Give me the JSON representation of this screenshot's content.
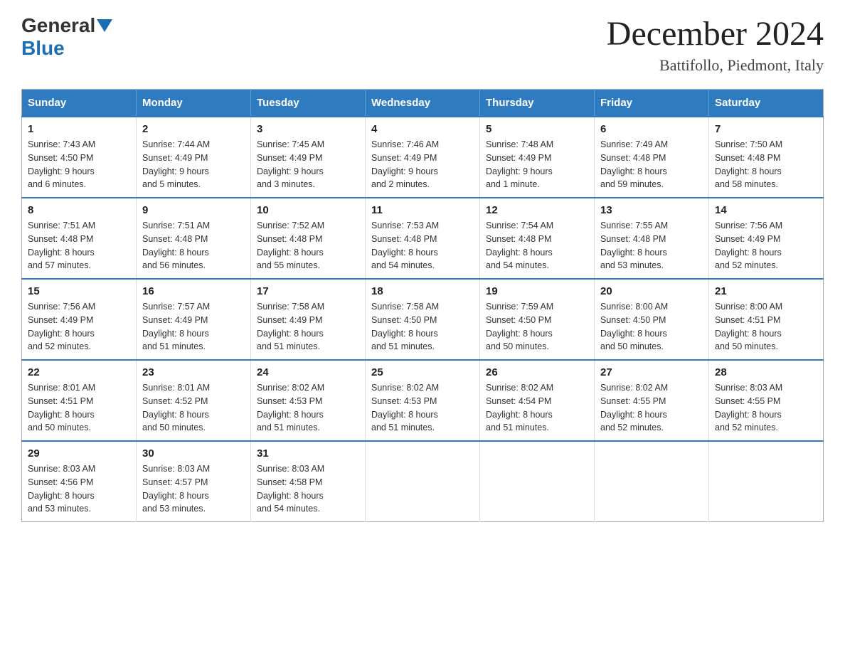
{
  "header": {
    "logo_general": "General",
    "logo_blue": "Blue",
    "month_year": "December 2024",
    "location": "Battifollo, Piedmont, Italy"
  },
  "days_of_week": [
    "Sunday",
    "Monday",
    "Tuesday",
    "Wednesday",
    "Thursday",
    "Friday",
    "Saturday"
  ],
  "weeks": [
    [
      {
        "day": "1",
        "sunrise": "7:43 AM",
        "sunset": "4:50 PM",
        "daylight": "9 hours and 6 minutes."
      },
      {
        "day": "2",
        "sunrise": "7:44 AM",
        "sunset": "4:49 PM",
        "daylight": "9 hours and 5 minutes."
      },
      {
        "day": "3",
        "sunrise": "7:45 AM",
        "sunset": "4:49 PM",
        "daylight": "9 hours and 3 minutes."
      },
      {
        "day": "4",
        "sunrise": "7:46 AM",
        "sunset": "4:49 PM",
        "daylight": "9 hours and 2 minutes."
      },
      {
        "day": "5",
        "sunrise": "7:48 AM",
        "sunset": "4:49 PM",
        "daylight": "9 hours and 1 minute."
      },
      {
        "day": "6",
        "sunrise": "7:49 AM",
        "sunset": "4:48 PM",
        "daylight": "8 hours and 59 minutes."
      },
      {
        "day": "7",
        "sunrise": "7:50 AM",
        "sunset": "4:48 PM",
        "daylight": "8 hours and 58 minutes."
      }
    ],
    [
      {
        "day": "8",
        "sunrise": "7:51 AM",
        "sunset": "4:48 PM",
        "daylight": "8 hours and 57 minutes."
      },
      {
        "day": "9",
        "sunrise": "7:51 AM",
        "sunset": "4:48 PM",
        "daylight": "8 hours and 56 minutes."
      },
      {
        "day": "10",
        "sunrise": "7:52 AM",
        "sunset": "4:48 PM",
        "daylight": "8 hours and 55 minutes."
      },
      {
        "day": "11",
        "sunrise": "7:53 AM",
        "sunset": "4:48 PM",
        "daylight": "8 hours and 54 minutes."
      },
      {
        "day": "12",
        "sunrise": "7:54 AM",
        "sunset": "4:48 PM",
        "daylight": "8 hours and 54 minutes."
      },
      {
        "day": "13",
        "sunrise": "7:55 AM",
        "sunset": "4:48 PM",
        "daylight": "8 hours and 53 minutes."
      },
      {
        "day": "14",
        "sunrise": "7:56 AM",
        "sunset": "4:49 PM",
        "daylight": "8 hours and 52 minutes."
      }
    ],
    [
      {
        "day": "15",
        "sunrise": "7:56 AM",
        "sunset": "4:49 PM",
        "daylight": "8 hours and 52 minutes."
      },
      {
        "day": "16",
        "sunrise": "7:57 AM",
        "sunset": "4:49 PM",
        "daylight": "8 hours and 51 minutes."
      },
      {
        "day": "17",
        "sunrise": "7:58 AM",
        "sunset": "4:49 PM",
        "daylight": "8 hours and 51 minutes."
      },
      {
        "day": "18",
        "sunrise": "7:58 AM",
        "sunset": "4:50 PM",
        "daylight": "8 hours and 51 minutes."
      },
      {
        "day": "19",
        "sunrise": "7:59 AM",
        "sunset": "4:50 PM",
        "daylight": "8 hours and 50 minutes."
      },
      {
        "day": "20",
        "sunrise": "8:00 AM",
        "sunset": "4:50 PM",
        "daylight": "8 hours and 50 minutes."
      },
      {
        "day": "21",
        "sunrise": "8:00 AM",
        "sunset": "4:51 PM",
        "daylight": "8 hours and 50 minutes."
      }
    ],
    [
      {
        "day": "22",
        "sunrise": "8:01 AM",
        "sunset": "4:51 PM",
        "daylight": "8 hours and 50 minutes."
      },
      {
        "day": "23",
        "sunrise": "8:01 AM",
        "sunset": "4:52 PM",
        "daylight": "8 hours and 50 minutes."
      },
      {
        "day": "24",
        "sunrise": "8:02 AM",
        "sunset": "4:53 PM",
        "daylight": "8 hours and 51 minutes."
      },
      {
        "day": "25",
        "sunrise": "8:02 AM",
        "sunset": "4:53 PM",
        "daylight": "8 hours and 51 minutes."
      },
      {
        "day": "26",
        "sunrise": "8:02 AM",
        "sunset": "4:54 PM",
        "daylight": "8 hours and 51 minutes."
      },
      {
        "day": "27",
        "sunrise": "8:02 AM",
        "sunset": "4:55 PM",
        "daylight": "8 hours and 52 minutes."
      },
      {
        "day": "28",
        "sunrise": "8:03 AM",
        "sunset": "4:55 PM",
        "daylight": "8 hours and 52 minutes."
      }
    ],
    [
      {
        "day": "29",
        "sunrise": "8:03 AM",
        "sunset": "4:56 PM",
        "daylight": "8 hours and 53 minutes."
      },
      {
        "day": "30",
        "sunrise": "8:03 AM",
        "sunset": "4:57 PM",
        "daylight": "8 hours and 53 minutes."
      },
      {
        "day": "31",
        "sunrise": "8:03 AM",
        "sunset": "4:58 PM",
        "daylight": "8 hours and 54 minutes."
      },
      null,
      null,
      null,
      null
    ]
  ],
  "labels": {
    "sunrise": "Sunrise:",
    "sunset": "Sunset:",
    "daylight": "Daylight:"
  }
}
